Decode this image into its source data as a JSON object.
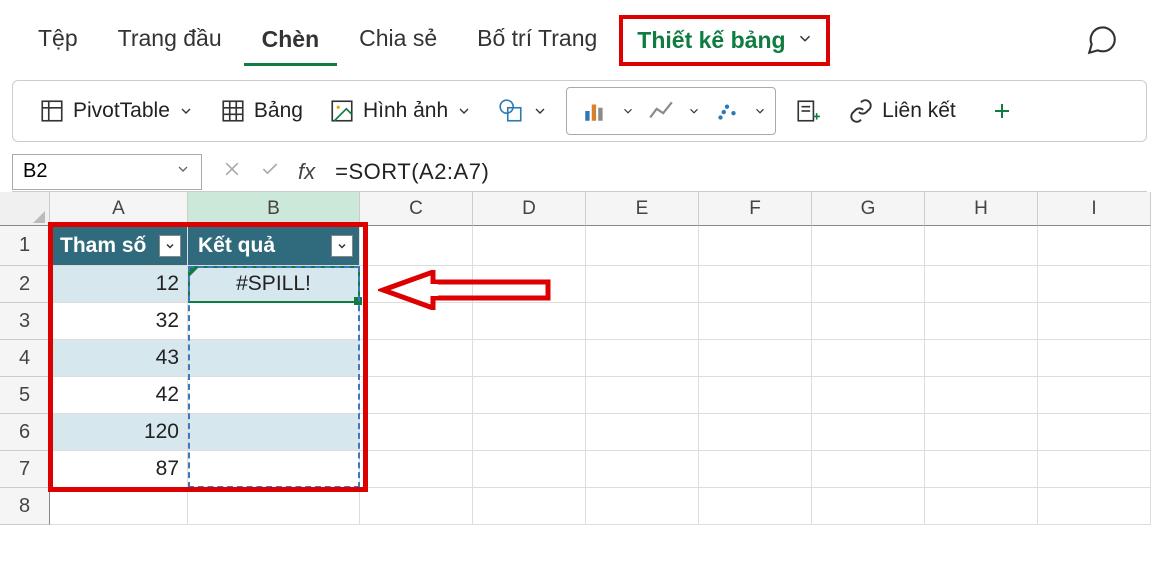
{
  "tabs": {
    "file": "Tệp",
    "home": "Trang đầu",
    "insert": "Chèn",
    "share": "Chia sẻ",
    "layout": "Bố trí Trang",
    "tabledesign": "Thiết kế bảng"
  },
  "ribbon": {
    "pivot": "PivotTable",
    "table": "Bảng",
    "image": "Hình ảnh",
    "link": "Liên kết"
  },
  "namebox": "B2",
  "formula": "=SORT(A2:A7)",
  "columns": [
    "A",
    "B",
    "C",
    "D",
    "E",
    "F",
    "G",
    "H",
    "I"
  ],
  "rows": [
    "1",
    "2",
    "3",
    "4",
    "5",
    "6",
    "7",
    "8"
  ],
  "table": {
    "headers": {
      "a": "Tham số",
      "b": "Kết quả"
    },
    "data": [
      {
        "a": "12",
        "b": "#SPILL!"
      },
      {
        "a": "32",
        "b": ""
      },
      {
        "a": "43",
        "b": ""
      },
      {
        "a": "42",
        "b": ""
      },
      {
        "a": "120",
        "b": ""
      },
      {
        "a": "87",
        "b": ""
      }
    ]
  }
}
